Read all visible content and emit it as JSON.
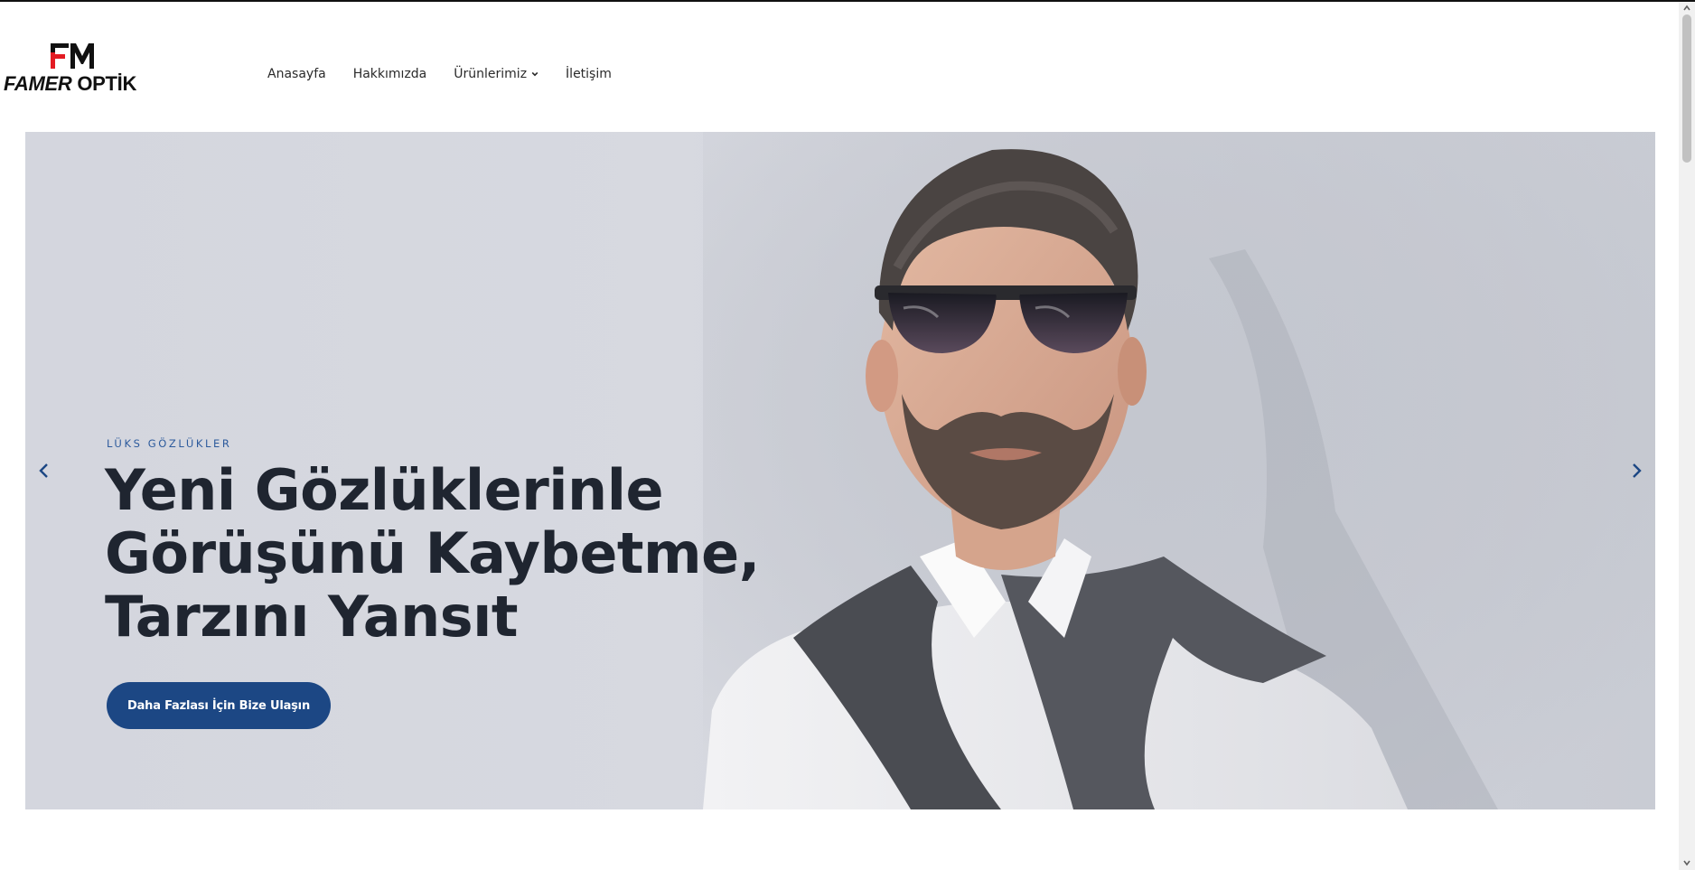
{
  "brand": {
    "name_part1": "FAMER",
    "name_part2": " OPTİK",
    "mark_icon": "fm-monogram-icon",
    "colors": {
      "red": "#e31b23",
      "dark": "#111111"
    }
  },
  "nav": {
    "items": [
      {
        "label": "Anasayfa"
      },
      {
        "label": "Hakkımızda"
      },
      {
        "label": "Ürünlerimiz",
        "icon": "chevron-down-icon"
      },
      {
        "label": "İletişim"
      }
    ]
  },
  "hero": {
    "eyebrow": "LÜKS GÖZLÜKLER",
    "title_lines": [
      "Yeni Gözlüklerinle",
      "Görüşünü Kaybetme,",
      "Tarzını Yansıt"
    ],
    "cta_label": "Daha Fazlası İçin Bize Ulaşın",
    "prev_icon": "chevron-left-icon",
    "next_icon": "chevron-right-icon",
    "colors": {
      "accent": "#1c4784",
      "title": "#1f2530",
      "eyebrow": "#2c5a9c"
    }
  }
}
